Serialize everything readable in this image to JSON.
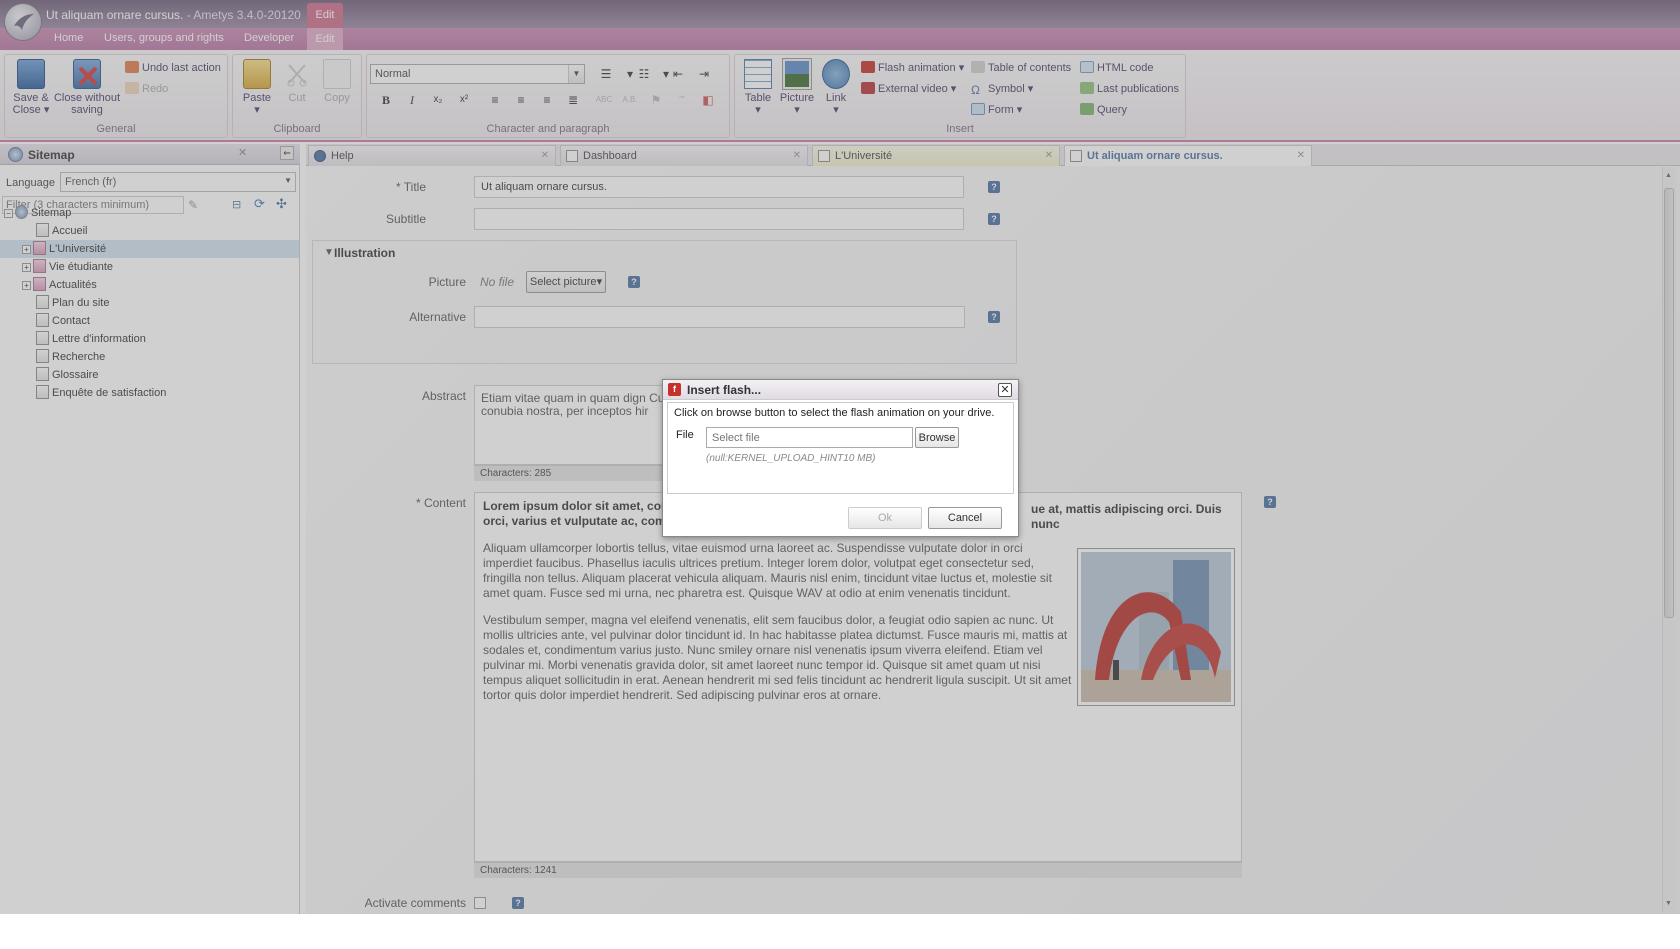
{
  "window": {
    "title": "Ut aliquam ornare cursus.",
    "app_name": "- Ametys 3.4.0-20120",
    "context_tab": "Edit"
  },
  "ribbon_tabs": [
    "Home",
    "Users, groups and rights",
    "Developer",
    "Edit"
  ],
  "ribbon": {
    "general": {
      "label": "General",
      "save_close": "Save & Close",
      "close_without_saving": "Close without saving",
      "undo": "Undo last action",
      "redo": "Redo"
    },
    "clipboard": {
      "label": "Clipboard",
      "paste": "Paste",
      "cut": "Cut",
      "copy": "Copy"
    },
    "character": {
      "label": "Character and paragraph",
      "style_value": "Normal"
    },
    "insert": {
      "label": "Insert",
      "table": "Table",
      "picture": "Picture",
      "link": "Link",
      "flash": "Flash animation",
      "external_video": "External video",
      "toc": "Table of contents",
      "symbol": "Symbol",
      "form": "Form",
      "html_code": "HTML code",
      "last_publications": "Last publications",
      "query": "Query"
    }
  },
  "sitemap": {
    "title": "Sitemap",
    "language_label": "Language",
    "language_value": "French (fr)",
    "filter_placeholder": "Filter (3 characters minimum)",
    "root": "Sitemap",
    "items": [
      "Accueil",
      "L'Université",
      "Vie étudiante",
      "Actualités",
      "Plan du site",
      "Contact",
      "Lettre d'information",
      "Recherche",
      "Glossaire",
      "Enquête de satisfaction"
    ]
  },
  "doc_tabs": [
    "Help",
    "Dashboard",
    "L'Université",
    "Ut aliquam ornare cursus."
  ],
  "form": {
    "title_label": "* Title",
    "title_value": "Ut aliquam ornare cursus.",
    "subtitle_label": "Subtitle",
    "illustration_label": "Illustration",
    "picture_label": "Picture",
    "picture_value": "No file",
    "select_picture": "Select picture",
    "alternative_label": "Alternative",
    "abstract_label": "Abstract",
    "abstract_text": "Etiam vitae quam in quam dign Curabitur eget ligula sed lacus dapibus ante id vestibulum. Cla conubia nostra, per inceptos hir",
    "abstract_counter": "Characters: 285",
    "content_label": "* Content",
    "content_p1": "Lorem ipsum dolor sit amet, cor orci, varius et vulputate ac, comr",
    "content_p1_right": "ue at, mattis adipiscing orci. Duis nunc",
    "content_p2": "Aliquam ullamcorper lobortis tellus, vitae euismod urna laoreet ac. Suspendisse vulputate dolor in orci imperdiet faucibus. Phasellus iaculis ultrices pretium. Integer lorem dolor, volutpat eget consectetur sed, fringilla non tellus. Aliquam placerat vehicula aliquam. Mauris nisl enim, tincidunt vitae luctus et, molestie sit amet quam. Fusce sed mi urna, nec pharetra est. Quisque WAV at odio at enim venenatis tincidunt.",
    "content_p3": "Vestibulum semper, magna vel eleifend venenatis, elit sem faucibus dolor, a feugiat odio sapien ac nunc. Ut mollis ultricies ante, vel pulvinar dolor tincidunt id. In hac habitasse platea dictumst. Fusce mauris mi, mattis at sodales et, condimentum varius justo. Nunc smiley ornare nisl venenatis ipsum viverra eleifend. Etiam vel pulvinar mi. Morbi venenatis gravida dolor, sit amet laoreet nunc tempor id. Quisque sit amet quam ut nisi tempus aliquet sollicitudin in erat. Aenean hendrerit mi sed felis tincidunt ac hendrerit ligula suscipit. Ut sit amet tortor quis dolor imperdiet hendrerit. Sed adipiscing pulvinar eros at ornare.",
    "content_counter": "Characters: 1241",
    "comments_label": "Activate comments"
  },
  "dialog": {
    "title": "Insert flash...",
    "instruction": "Click on browse button to select the flash animation on your drive.",
    "file_label": "File",
    "file_placeholder": "Select file",
    "browse": "Browse",
    "hint": "(null:KERNEL_UPLOAD_HINT10 MB)",
    "ok": "Ok",
    "cancel": "Cancel"
  },
  "colors": {
    "accent": "#c87aab",
    "ribbon_tab_bg": "#b877a5",
    "link_blue": "#4a6fa2"
  }
}
